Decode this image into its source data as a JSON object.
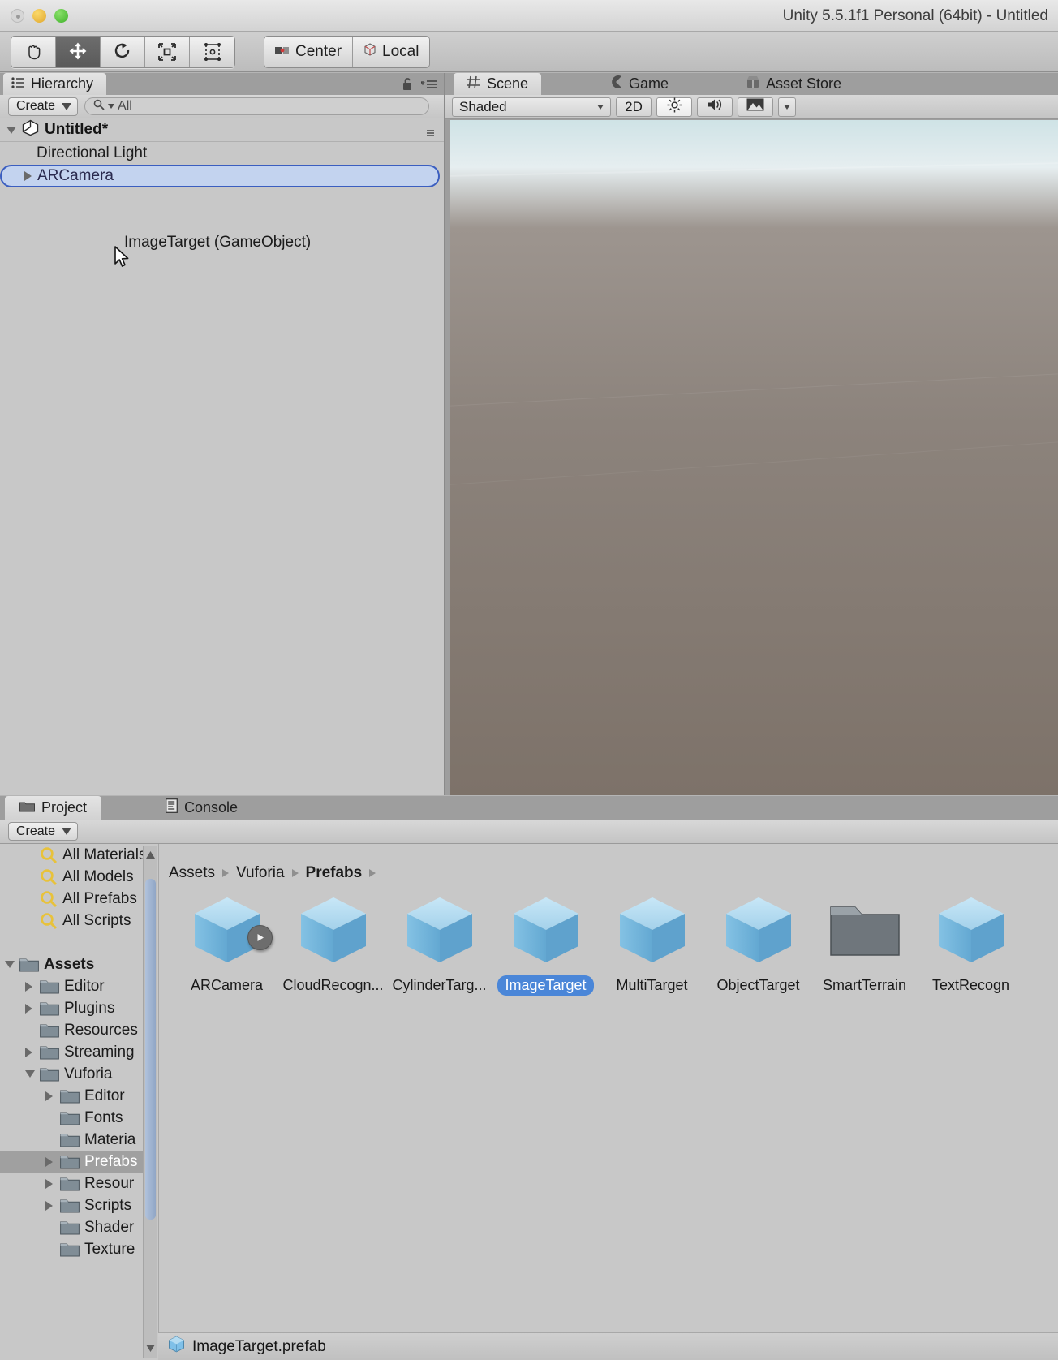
{
  "window": {
    "title": "Unity 5.5.1f1 Personal (64bit) - Untitled",
    "traffic": {
      "close": "close-button",
      "minimize": "minimize-button",
      "maximize": "maximize-button"
    }
  },
  "toolbar": {
    "tools": [
      {
        "name": "hand-tool",
        "active": false
      },
      {
        "name": "move-tool",
        "active": true
      },
      {
        "name": "rotate-tool",
        "active": false
      },
      {
        "name": "scale-tool",
        "active": false
      },
      {
        "name": "rect-tool",
        "active": false
      }
    ],
    "pivot_label": "Center",
    "space_label": "Local"
  },
  "hierarchy": {
    "tab_label": "Hierarchy",
    "create_label": "Create",
    "search_placeholder": "All",
    "scene_name": "Untitled*",
    "items": [
      {
        "label": "Directional Light",
        "expandable": false,
        "selected": false
      },
      {
        "label": "ARCamera",
        "expandable": true,
        "selected": true
      }
    ],
    "drag_ghost_label": "ImageTarget (GameObject)"
  },
  "sceneview": {
    "tabs": [
      {
        "label": "Scene",
        "icon": "grid-icon",
        "active": true
      },
      {
        "label": "Game",
        "icon": "gamepad-icon",
        "active": false
      },
      {
        "label": "Asset Store",
        "icon": "store-icon",
        "active": false
      }
    ],
    "shading_mode": "Shaded",
    "two_d_label": "2D",
    "lighting_icon": "sun-icon",
    "audio_icon": "speaker-icon",
    "effects_icon": "image-icon"
  },
  "project": {
    "tabs": [
      {
        "label": "Project",
        "icon": "folder-icon",
        "active": true
      },
      {
        "label": "Console",
        "icon": "console-icon",
        "active": false
      }
    ],
    "create_label": "Create",
    "tree": [
      {
        "label": "All Materials",
        "indent": 1,
        "icon": "search-icon",
        "arrow": "none",
        "selected": false,
        "bold": false
      },
      {
        "label": "All Models",
        "indent": 1,
        "icon": "search-icon",
        "arrow": "none",
        "selected": false,
        "bold": false
      },
      {
        "label": "All Prefabs",
        "indent": 1,
        "icon": "search-icon",
        "arrow": "none",
        "selected": false,
        "bold": false
      },
      {
        "label": "All Scripts",
        "indent": 1,
        "icon": "search-icon",
        "arrow": "none",
        "selected": false,
        "bold": false
      },
      {
        "label": "",
        "indent": 0,
        "icon": "none",
        "arrow": "none",
        "selected": false,
        "bold": false
      },
      {
        "label": "Assets",
        "indent": 0,
        "icon": "folder-icon",
        "arrow": "down",
        "selected": false,
        "bold": true
      },
      {
        "label": "Editor",
        "indent": 1,
        "icon": "folder-icon",
        "arrow": "right",
        "selected": false,
        "bold": false
      },
      {
        "label": "Plugins",
        "indent": 1,
        "icon": "folder-icon",
        "arrow": "right",
        "selected": false,
        "bold": false
      },
      {
        "label": "Resources",
        "indent": 1,
        "icon": "folder-icon",
        "arrow": "none",
        "selected": false,
        "bold": false
      },
      {
        "label": "Streaming",
        "indent": 1,
        "icon": "folder-icon",
        "arrow": "right",
        "selected": false,
        "bold": false
      },
      {
        "label": "Vuforia",
        "indent": 1,
        "icon": "folder-icon",
        "arrow": "down",
        "selected": false,
        "bold": false
      },
      {
        "label": "Editor",
        "indent": 2,
        "icon": "folder-icon",
        "arrow": "right",
        "selected": false,
        "bold": false
      },
      {
        "label": "Fonts",
        "indent": 2,
        "icon": "folder-icon",
        "arrow": "none",
        "selected": false,
        "bold": false
      },
      {
        "label": "Materia",
        "indent": 2,
        "icon": "folder-icon",
        "arrow": "none",
        "selected": false,
        "bold": false
      },
      {
        "label": "Prefabs",
        "indent": 2,
        "icon": "folder-icon",
        "arrow": "right",
        "selected": true,
        "bold": false
      },
      {
        "label": "Resour",
        "indent": 2,
        "icon": "folder-icon",
        "arrow": "right",
        "selected": false,
        "bold": false
      },
      {
        "label": "Scripts",
        "indent": 2,
        "icon": "folder-icon",
        "arrow": "right",
        "selected": false,
        "bold": false
      },
      {
        "label": "Shader",
        "indent": 2,
        "icon": "folder-icon",
        "arrow": "none",
        "selected": false,
        "bold": false
      },
      {
        "label": "Texture",
        "indent": 2,
        "icon": "folder-icon",
        "arrow": "none",
        "selected": false,
        "bold": false
      }
    ],
    "breadcrumb": [
      {
        "label": "Assets",
        "current": false
      },
      {
        "label": "Vuforia",
        "current": false
      },
      {
        "label": "Prefabs",
        "current": true
      }
    ],
    "assets": [
      {
        "label": "ARCamera",
        "icon": "prefab-cube-icon",
        "selected": false,
        "badge": "play-badge"
      },
      {
        "label": "CloudRecogn...",
        "icon": "prefab-cube-icon",
        "selected": false,
        "badge": ""
      },
      {
        "label": "CylinderTarg...",
        "icon": "prefab-cube-icon",
        "selected": false,
        "badge": ""
      },
      {
        "label": "ImageTarget",
        "icon": "prefab-cube-icon",
        "selected": true,
        "badge": ""
      },
      {
        "label": "MultiTarget",
        "icon": "prefab-cube-icon",
        "selected": false,
        "badge": ""
      },
      {
        "label": "ObjectTarget",
        "icon": "prefab-cube-icon",
        "selected": false,
        "badge": ""
      },
      {
        "label": "SmartTerrain",
        "icon": "folder-large-icon",
        "selected": false,
        "badge": ""
      },
      {
        "label": "TextRecogn",
        "icon": "prefab-cube-icon",
        "selected": false,
        "badge": ""
      }
    ],
    "footer_file": "ImageTarget.prefab"
  },
  "colors": {
    "selection_blue": "#4a86d8",
    "hierarchy_select": "#c3d3ef",
    "hierarchy_outline": "#3b5ec0",
    "panel_bg": "#c8c8c8",
    "tabbar_bg": "#9e9e9e"
  }
}
